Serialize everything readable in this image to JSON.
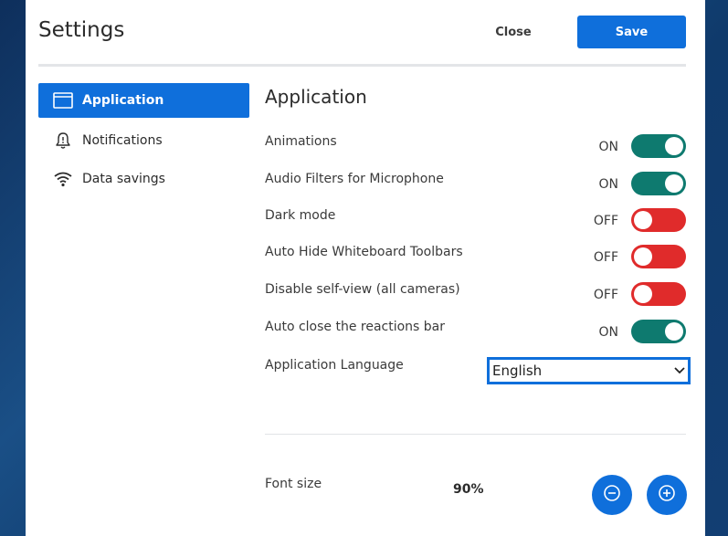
{
  "header": {
    "title": "Settings",
    "close_label": "Close",
    "save_label": "Save"
  },
  "sidebar": {
    "items": [
      {
        "label": "Application",
        "icon": "window-icon",
        "active": true
      },
      {
        "label": "Notifications",
        "icon": "bell-icon",
        "active": false
      },
      {
        "label": "Data savings",
        "icon": "wifi-icon",
        "active": false
      }
    ]
  },
  "main": {
    "section_title": "Application",
    "settings": [
      {
        "label": "Animations",
        "state": "ON"
      },
      {
        "label": "Audio Filters for Microphone",
        "state": "ON"
      },
      {
        "label": "Dark mode",
        "state": "OFF"
      },
      {
        "label": "Auto Hide Whiteboard Toolbars",
        "state": "OFF"
      },
      {
        "label": "Disable self-view (all cameras)",
        "state": "OFF"
      },
      {
        "label": "Auto close the reactions bar",
        "state": "ON"
      }
    ],
    "language": {
      "label": "Application Language",
      "value": "English"
    },
    "font_size": {
      "label": "Font size",
      "value": "90%"
    }
  },
  "colors": {
    "accent": "#0f6fdb",
    "toggle_on": "#0e7a6f",
    "toggle_off": "#e02b2b"
  }
}
